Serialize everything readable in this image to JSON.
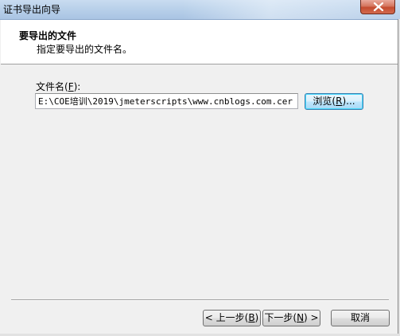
{
  "window": {
    "title": "证书导出向导",
    "close_icon": "close-icon"
  },
  "header": {
    "title": "要导出的文件",
    "subtitle": "指定要导出的文件名。"
  },
  "form": {
    "filename_label": "文件名",
    "filename_label_accel": "F",
    "filename_label_suffix": "):",
    "filename_value": "E:\\COE培训\\2019\\jmeterscripts\\www.cnblogs.com.cer",
    "browse_label_prefix": "浏览(",
    "browse_accel": "R",
    "browse_label_suffix": ")..."
  },
  "buttons": {
    "back_prefix": "< 上一步(",
    "back_accel": "B",
    "back_suffix": ")",
    "next_prefix": "下一步(",
    "next_accel": "N",
    "next_suffix": ") >",
    "cancel": "取消"
  }
}
